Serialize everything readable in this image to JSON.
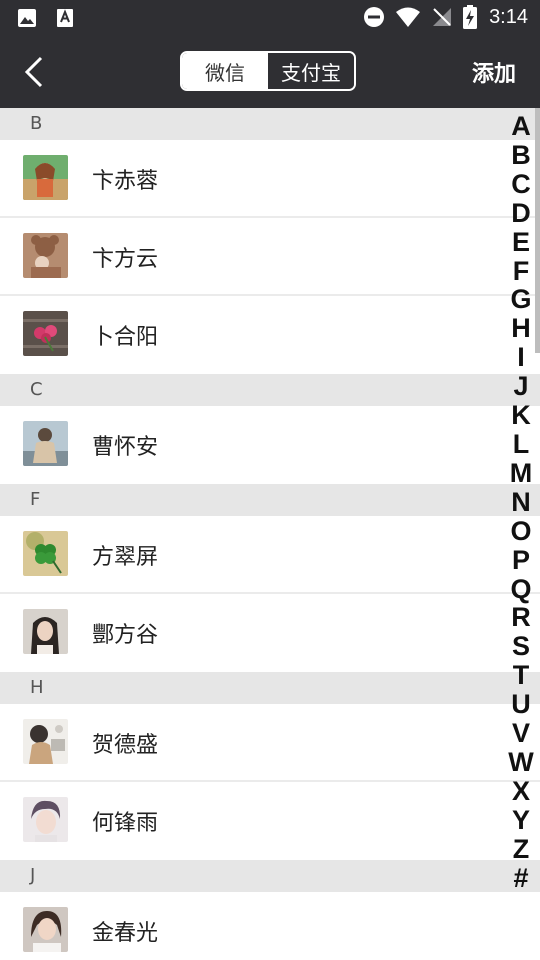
{
  "status_bar": {
    "time": "3:14"
  },
  "nav": {
    "tabs": [
      {
        "label": "微信",
        "active": false
      },
      {
        "label": "支付宝",
        "active": true
      }
    ],
    "add_label": "添加"
  },
  "sections": [
    {
      "letter": "B",
      "contacts": [
        {
          "name": "卞赤蓉"
        },
        {
          "name": "卞方云"
        },
        {
          "name": "卜合阳"
        }
      ]
    },
    {
      "letter": "C",
      "contacts": [
        {
          "name": "曹怀安"
        }
      ]
    },
    {
      "letter": "F",
      "contacts": [
        {
          "name": "方翠屏"
        },
        {
          "name": "酆方谷"
        }
      ]
    },
    {
      "letter": "H",
      "contacts": [
        {
          "name": "贺德盛"
        },
        {
          "name": "何锋雨"
        }
      ]
    },
    {
      "letter": "J",
      "contacts": [
        {
          "name": "金春光"
        }
      ]
    }
  ],
  "index_letters": [
    "A",
    "B",
    "C",
    "D",
    "E",
    "F",
    "G",
    "H",
    "I",
    "J",
    "K",
    "L",
    "M",
    "N",
    "O",
    "P",
    "Q",
    "R",
    "S",
    "T",
    "U",
    "V",
    "W",
    "X",
    "Y",
    "Z",
    "#"
  ],
  "colors": {
    "header_bg": "#2f2f33",
    "section_bg": "#e6e6e6",
    "row_bg": "#ffffff"
  }
}
